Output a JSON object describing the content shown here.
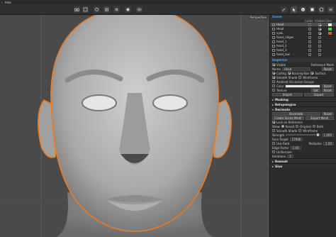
{
  "menu": {
    "back": "‹",
    "help": "Help"
  },
  "toolbar": {
    "buttons": [
      "camera-icon",
      "frame-icon",
      "rotate-icon",
      "grid-icon",
      "settings-icon",
      "visibility-icon",
      "eye-icon"
    ],
    "right_buttons": [
      "brush-icon",
      "cursor-icon",
      "info-icon",
      "layers-icon",
      "palette-icon",
      "list-icon"
    ]
  },
  "viewport": {
    "label": "Perspective"
  },
  "scene": {
    "title": "Scene",
    "columns": [
      "",
      "Culler",
      "Visible",
      "Color"
    ],
    "items": [
      {
        "name": "Head",
        "culler": false,
        "visible": true,
        "color": "#e8e8e8",
        "selected": true
      },
      {
        "name": "Head",
        "culler": false,
        "visible": true,
        "color": "#55d43a",
        "selected": false
      },
      {
        "name": "eyeL",
        "culler": false,
        "visible": true,
        "color": "#e05a1a",
        "selected": false
      },
      {
        "name": "head_ridges",
        "culler": false,
        "visible": false,
        "color": "",
        "selected": false
      },
      {
        "name": "head_1",
        "culler": false,
        "visible": false,
        "color": "",
        "selected": false
      },
      {
        "name": "head_2",
        "culler": false,
        "visible": false,
        "color": "",
        "selected": false
      },
      {
        "name": "head_3",
        "culler": false,
        "visible": false,
        "color": "",
        "selected": false
      },
      {
        "name": "head_low",
        "culler": false,
        "visible": false,
        "color": "",
        "selected": false
      }
    ]
  },
  "inspector": {
    "title": "Inspector",
    "visible_label": "Visible",
    "ref_mesh_label": "Reference Mesh",
    "name_label": "Name",
    "name_value": "Head",
    "reset": "Reset",
    "checks": [
      "Culling",
      "Backing Box",
      "Surface",
      "Smooth Shade",
      "Wireframe",
      "Ambient Occlusion Groups"
    ],
    "color_label": "Color",
    "texture_label": "Texture",
    "set_label": "Set",
    "import_label": "Import",
    "export_label": "Export",
    "sections": [
      {
        "name": "Masking",
        "open": false
      },
      {
        "name": "Retopologize",
        "open": false
      },
      {
        "name": "Decimate",
        "open": true
      }
    ],
    "decimate": {
      "decimate_btn": "Decimate",
      "create_scene_mesh": "Create Scene Mesh",
      "export_mesh": "Export Mesh",
      "lock_ref": "Lock on Reference",
      "show_label": "Show",
      "show_options": [
        "Result",
        "Original",
        "Both"
      ],
      "smooth_shade": "Smooth Shade",
      "wireframe": "Wireframe",
      "strength_label": "Strength",
      "strength_value": "1.000",
      "face_target_label": "Face Target",
      "face_target_value": "27946",
      "use_field": "Use Field",
      "multiplier_label": "Multiplier",
      "multiplier_value": "1.00",
      "edge_label": "Edge Factor",
      "edge_value": "1.00",
      "uniform": "Uniformize",
      "iterations_label": "Iterations",
      "iterations_value": "3"
    },
    "bottom_sections": [
      "Remesh",
      "Glue"
    ]
  },
  "colors": {
    "accent": "#4aa3ff",
    "outline": "#f07a1e",
    "viewport": "#4a4a4a"
  }
}
